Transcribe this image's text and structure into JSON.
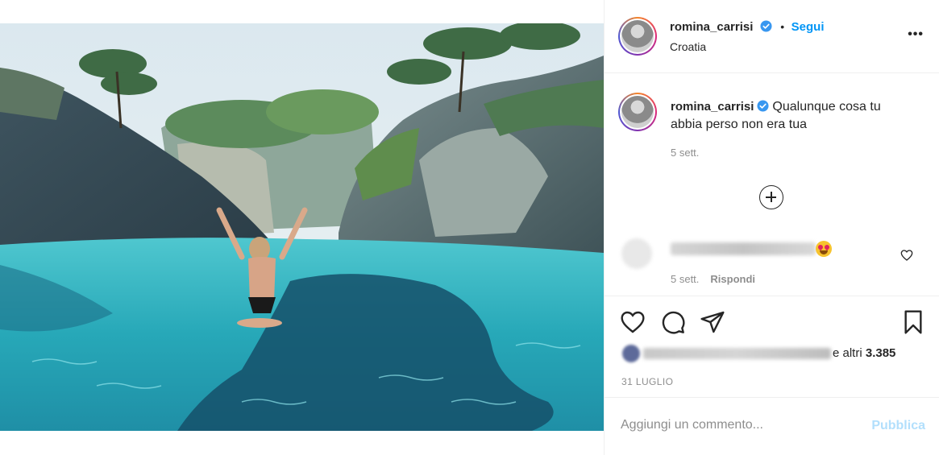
{
  "colors": {
    "accent": "#0095f6",
    "publish_disabled": "#b2dffc",
    "muted": "#8e8e8e"
  },
  "post": {
    "image_alt": "Woman with raised arms sitting in turquoise water of a rocky cove"
  },
  "header": {
    "username": "romina_carrisi",
    "verified": true,
    "separator": "•",
    "follow_label": "Segui",
    "location": "Croatia",
    "more_icon": "more-dots-icon",
    "more_label": "•••"
  },
  "caption": {
    "username": "romina_carrisi",
    "text": "Qualunque cosa tu abbia perso non era tua",
    "time": "5 sett.",
    "load_more_icon": "plus-circle-icon"
  },
  "comment": {
    "time": "5 sett.",
    "reply_label": "Rispondi",
    "emoji": "heart-eyes-emoji"
  },
  "actions": {
    "icons": [
      "heart-icon",
      "comment-icon",
      "share-icon",
      "bookmark-icon"
    ],
    "likes_suffix": "e altri",
    "likes_count": "3.385",
    "date": "31 LUGLIO"
  },
  "add_comment": {
    "placeholder": "Aggiungi un commento...",
    "publish_label": "Pubblica"
  }
}
